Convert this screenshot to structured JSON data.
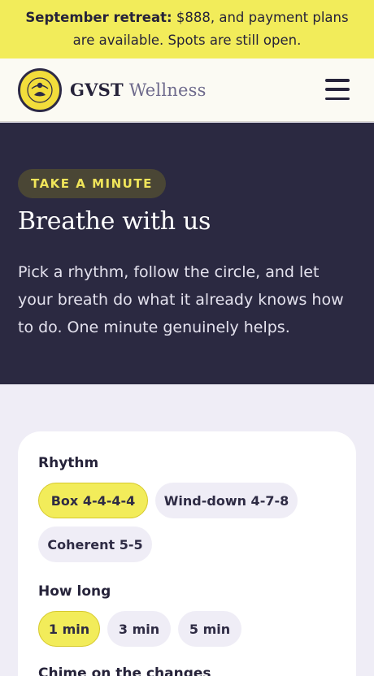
{
  "banner": {
    "bold": "September retreat:",
    "text": " $888, and payment plans are available. Spots are still open."
  },
  "header": {
    "brand_main": "GVST",
    "brand_sub": " Wellness",
    "logo_text_top": "GVST",
    "logo_text_bottom": "WELLNESS"
  },
  "hero": {
    "tag": "TAKE A MINUTE",
    "title": "Breathe with us",
    "body": "Pick a rhythm, follow the circle, and let your breath do what it already knows how to do. One minute genuinely helps."
  },
  "controls": {
    "rhythm_label": "Rhythm",
    "rhythms": [
      "Box 4-4-4-4",
      "Wind-down 4-7-8",
      "Coherent 5-5"
    ],
    "rhythm_selected": "Box 4-4-4-4",
    "duration_label": "How long",
    "durations": [
      "1 min",
      "3 min",
      "5 min"
    ],
    "duration_selected": "1 min",
    "chime_label": "Chime on the changes"
  },
  "colors": {
    "accent_yellow": "#f2ec5a",
    "hero_bg": "#2b2941",
    "page_bg": "#efedf6"
  }
}
